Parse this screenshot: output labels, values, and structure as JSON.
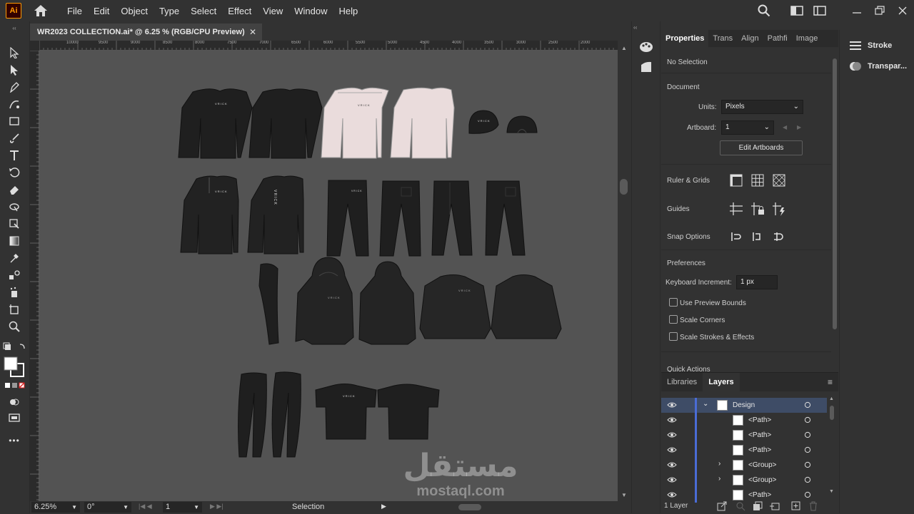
{
  "app": {
    "logo": "Ai"
  },
  "menu": [
    "File",
    "Edit",
    "Object",
    "Type",
    "Select",
    "Effect",
    "View",
    "Window",
    "Help"
  ],
  "document": {
    "tab_title": "WR2023 COLLECTION.ai* @ 6.25 % (RGB/CPU Preview)",
    "close": "✕"
  },
  "ruler": [
    "10000",
    "9500",
    "9000",
    "8500",
    "8000",
    "7500",
    "7000",
    "6500",
    "6000",
    "5500",
    "5000",
    "4500",
    "4000",
    "3500",
    "3000",
    "2500",
    "2000"
  ],
  "artwork": {
    "logo_text": "V R I C K",
    "garments": [
      {
        "kind": "longsleeve",
        "color": "#1f1f1f",
        "logo": true
      },
      {
        "kind": "longsleeve",
        "color": "#1f1f1f",
        "logo": false
      },
      {
        "kind": "longsleeve",
        "color": "#eadcdc",
        "logo": true
      },
      {
        "kind": "longsleeve",
        "color": "#eadcdc",
        "logo": false
      },
      {
        "kind": "cap",
        "color": "#1f1f1f",
        "logo": true
      },
      {
        "kind": "cap-back",
        "color": "#1f1f1f",
        "logo": false
      },
      {
        "kind": "zip-top",
        "color": "#222222",
        "logo": true
      },
      {
        "kind": "zip-top",
        "color": "#222222",
        "logo": true
      },
      {
        "kind": "pants",
        "color": "#1f1f1f",
        "logo": true
      },
      {
        "kind": "pants",
        "color": "#1f1f1f",
        "logo": false
      },
      {
        "kind": "cargo",
        "color": "#1f1f1f",
        "logo": false
      },
      {
        "kind": "cargo",
        "color": "#1f1f1f",
        "logo": false
      },
      {
        "kind": "legging-side",
        "color": "#1f1f1f",
        "logo": false
      },
      {
        "kind": "hoodie",
        "color": "#242424",
        "logo": true
      },
      {
        "kind": "hoodie",
        "color": "#242424",
        "logo": false
      },
      {
        "kind": "sweatshirt",
        "color": "#262626",
        "logo": true
      },
      {
        "kind": "sweatshirt",
        "color": "#262626",
        "logo": false
      },
      {
        "kind": "leggings",
        "color": "#1f1f1f",
        "logo": false
      },
      {
        "kind": "tshirt",
        "color": "#1f1f1f",
        "logo": true
      },
      {
        "kind": "tshirt",
        "color": "#1f1f1f",
        "logo": false
      }
    ]
  },
  "status": {
    "zoom": "6.25%",
    "rotation": "0°",
    "artboard": "1",
    "tool": "Selection"
  },
  "properties": {
    "tabs": [
      "Properties",
      "Trans",
      "Align",
      "Pathfi",
      "Image"
    ],
    "no_selection": "No Selection",
    "document_heading": "Document",
    "units_label": "Units:",
    "units_value": "Pixels",
    "artboard_label": "Artboard:",
    "artboard_value": "1",
    "edit_artboards": "Edit Artboards",
    "ruler_grids": "Ruler & Grids",
    "guides": "Guides",
    "snap_options": "Snap Options",
    "preferences": "Preferences",
    "keyboard_increment_label": "Keyboard Increment:",
    "keyboard_increment_value": "1 px",
    "use_preview_bounds": "Use Preview Bounds",
    "scale_corners": "Scale Corners",
    "scale_strokes": "Scale Strokes & Effects",
    "quick_actions": "Quick Actions"
  },
  "layers": {
    "tabs": [
      "Libraries",
      "Layers"
    ],
    "rows": [
      {
        "name": "Design",
        "expanded": true,
        "top": true
      },
      {
        "name": "<Path>"
      },
      {
        "name": "<Path>"
      },
      {
        "name": "<Path>"
      },
      {
        "name": "<Group>",
        "expander": true
      },
      {
        "name": "<Group>",
        "expander": true
      },
      {
        "name": "<Path>"
      }
    ],
    "count": "1 Layer"
  },
  "far_panel": [
    "Stroke",
    "Transpar..."
  ],
  "watermark": {
    "arabic": "مستقل",
    "latin": "mostaql.com"
  }
}
